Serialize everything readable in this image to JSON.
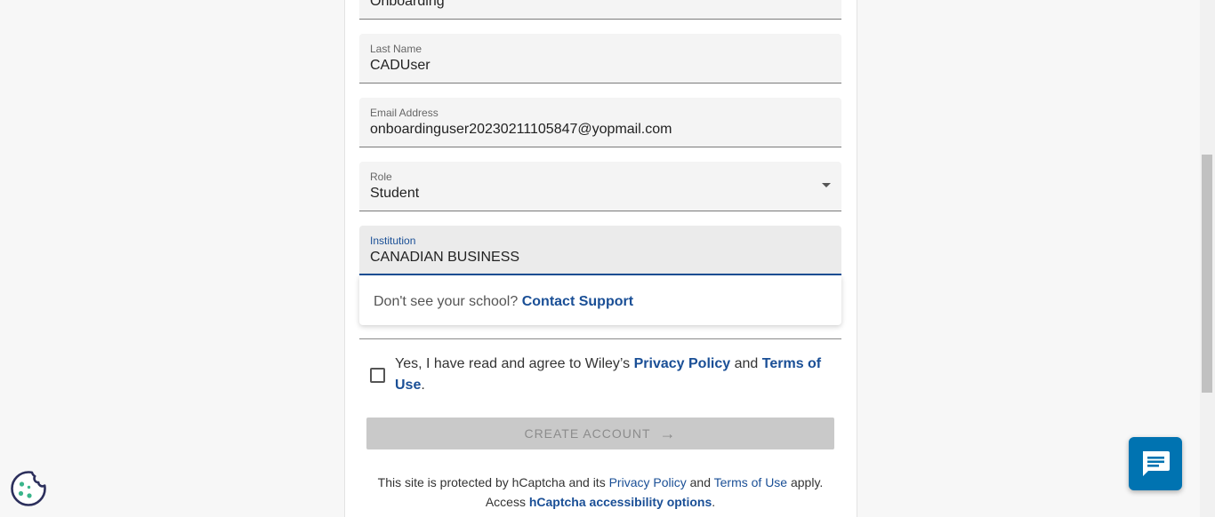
{
  "form": {
    "first_name": {
      "value": "Onboarding"
    },
    "last_name": {
      "label": "Last Name",
      "value": "CADUser"
    },
    "email": {
      "label": "Email Address",
      "value": "onboardinguser20230211105847@yopmail.com"
    },
    "role": {
      "label": "Role",
      "value": "Student"
    },
    "institution": {
      "label": "Institution",
      "value": "CANADIAN BUSINESS"
    }
  },
  "suggestion": {
    "prefix": "Don't see your school?",
    "link": "Contact Support"
  },
  "agreement": {
    "prefix": "Yes, I have read and agree to Wiley’s",
    "privacy": "Privacy Policy",
    "and": "and",
    "terms": "Terms of Use",
    "end": "."
  },
  "create_button": {
    "label": "CREATE ACCOUNT",
    "icon": "arrow-right-icon"
  },
  "captcha": {
    "prefix": "This site is protected by hCaptcha and its",
    "privacy": "Privacy Policy",
    "and": "and",
    "terms": "Terms of Use",
    "suffix": "apply.",
    "access": "Access",
    "accessibility": "hCaptcha accessibility options",
    "end": "."
  },
  "colors": {
    "link": "#1a4f96",
    "chat_button": "#0073b1",
    "cookie_accent": "#3bb58b",
    "cookie_outline": "#2c2f5c"
  },
  "icons": {
    "cookie": "cookie-icon",
    "chat": "chat-icon",
    "dropdown": "dropdown-arrow-icon"
  }
}
